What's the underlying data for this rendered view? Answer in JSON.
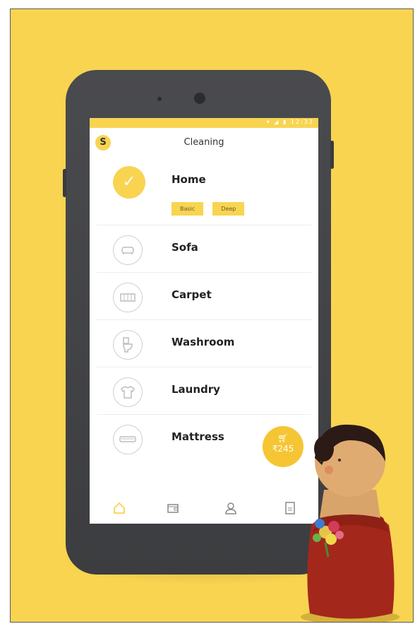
{
  "colors": {
    "accent": "#f8d451",
    "phone": "#3f4043",
    "cart": "#f6c533"
  },
  "statusbar": {
    "icons": "▾ ◢ ▮ 12:32"
  },
  "header": {
    "logo": "S",
    "title": "Cleaning"
  },
  "services": [
    {
      "label": "Home",
      "icon": "checkmark-icon",
      "selected": true,
      "options": [
        "Basic",
        "Deep"
      ]
    },
    {
      "label": "Sofa",
      "icon": "sofa-icon"
    },
    {
      "label": "Carpet",
      "icon": "carpet-icon"
    },
    {
      "label": "Washroom",
      "icon": "toilet-icon"
    },
    {
      "label": "Laundry",
      "icon": "shirt-icon"
    },
    {
      "label": "Mattress",
      "icon": "mattress-icon"
    }
  ],
  "cart": {
    "icon": "cart-icon",
    "amount": "₹245"
  },
  "bottom_nav": [
    {
      "icon": "home-icon",
      "active": true
    },
    {
      "icon": "wallet-icon"
    },
    {
      "icon": "profile-icon"
    },
    {
      "icon": "document-icon"
    }
  ]
}
